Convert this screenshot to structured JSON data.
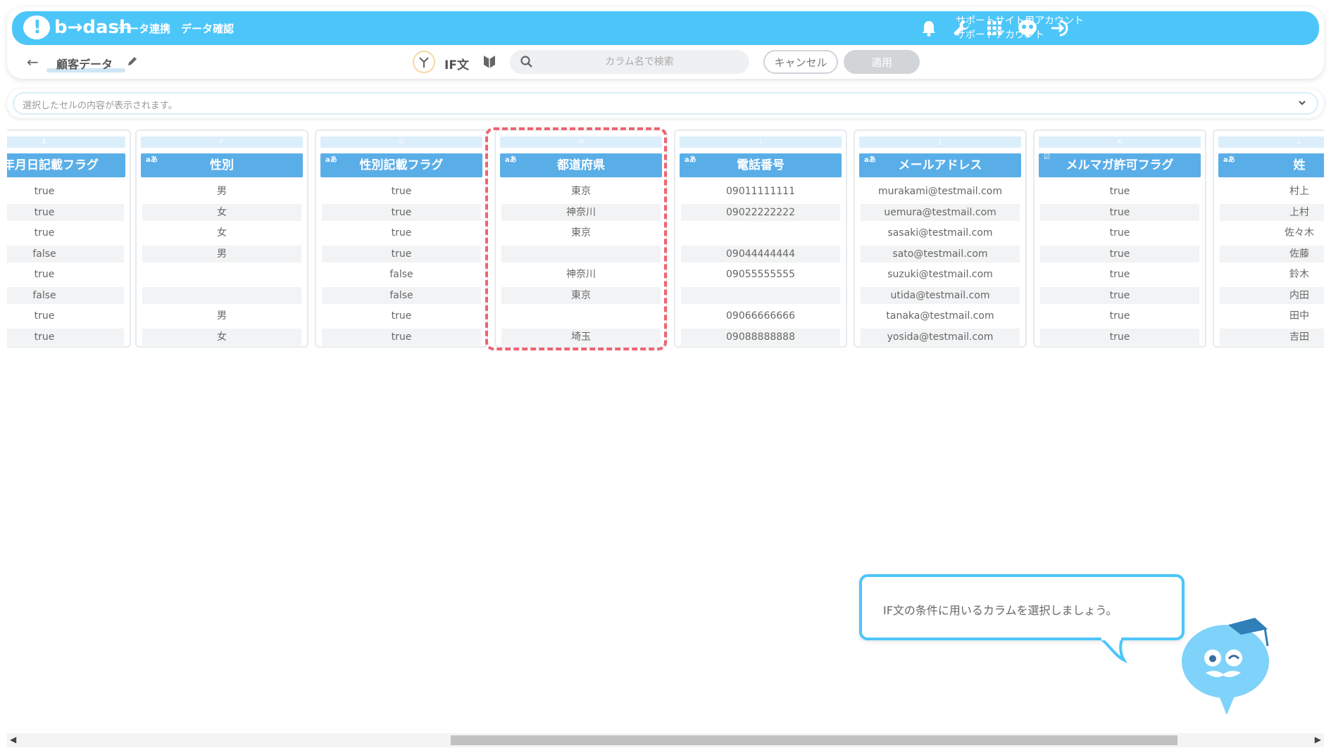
{
  "header": {
    "logo_text": "b→dash",
    "nav": [
      "データ連携",
      "データ確認"
    ],
    "account_line1": "サポートサイト用アカウント",
    "account_line2": "サポートアカウント",
    "icons": [
      "bell-icon",
      "wrench-icon",
      "apps-grid-icon",
      "mascot-help-icon",
      "logout-icon"
    ]
  },
  "subbar": {
    "dataset_name": "顧客データ",
    "if_label": "IF文",
    "search_placeholder": "カラム名で検索",
    "cancel_label": "キャンセル",
    "apply_label": "適用"
  },
  "cell_bar": {
    "text": "選択したセルの内容が表示されます。"
  },
  "table": {
    "columns": [
      {
        "letter": "E",
        "type": "aあ",
        "header": "生年月日記載フラグ",
        "cells": [
          "true",
          "true",
          "true",
          "false",
          "true",
          "false",
          "true",
          "true"
        ]
      },
      {
        "letter": "F",
        "type": "aあ",
        "header": "性別",
        "cells": [
          "男",
          "女",
          "女",
          "男",
          "",
          "",
          "男",
          "女"
        ]
      },
      {
        "letter": "G",
        "type": "aあ",
        "header": "性別記載フラグ",
        "cells": [
          "true",
          "true",
          "true",
          "true",
          "false",
          "false",
          "true",
          "true"
        ]
      },
      {
        "letter": "H",
        "type": "aあ",
        "header": "都道府県",
        "cells": [
          "東京",
          "神奈川",
          "東京",
          "",
          "神奈川",
          "東京",
          "",
          "埼玉"
        ]
      },
      {
        "letter": "I",
        "type": "aあ",
        "header": "電話番号",
        "cells": [
          "09011111111",
          "09022222222",
          "",
          "09044444444",
          "09055555555",
          "",
          "09066666666",
          "09088888888"
        ]
      },
      {
        "letter": "J",
        "type": "aあ",
        "header": "メールアドレス",
        "cells": [
          "murakami@testmail.com",
          "uemura@testmail.com",
          "sasaki@testmail.com",
          "sato@testmail.com",
          "suzuki@testmail.com",
          "utida@testmail.com",
          "tanaka@testmail.com",
          "yosida@testmail.com"
        ]
      },
      {
        "letter": "K",
        "type": "☑",
        "header": "メルマガ許可フラグ",
        "cells": [
          "true",
          "true",
          "true",
          "true",
          "true",
          "true",
          "true",
          "true"
        ]
      },
      {
        "letter": "L",
        "type": "aあ",
        "header": "姓",
        "cells": [
          "村上",
          "上村",
          "佐々木",
          "佐藤",
          "鈴木",
          "内田",
          "田中",
          "吉田"
        ]
      }
    ],
    "highlighted_column": "H"
  },
  "tutorial": {
    "bubble_text": "IF文の条件に用いるカラムを選択しましょう。"
  },
  "colors": {
    "brand": "#4cc6f9",
    "header_cell": "#5aaee8",
    "highlight": "#ef6472"
  }
}
